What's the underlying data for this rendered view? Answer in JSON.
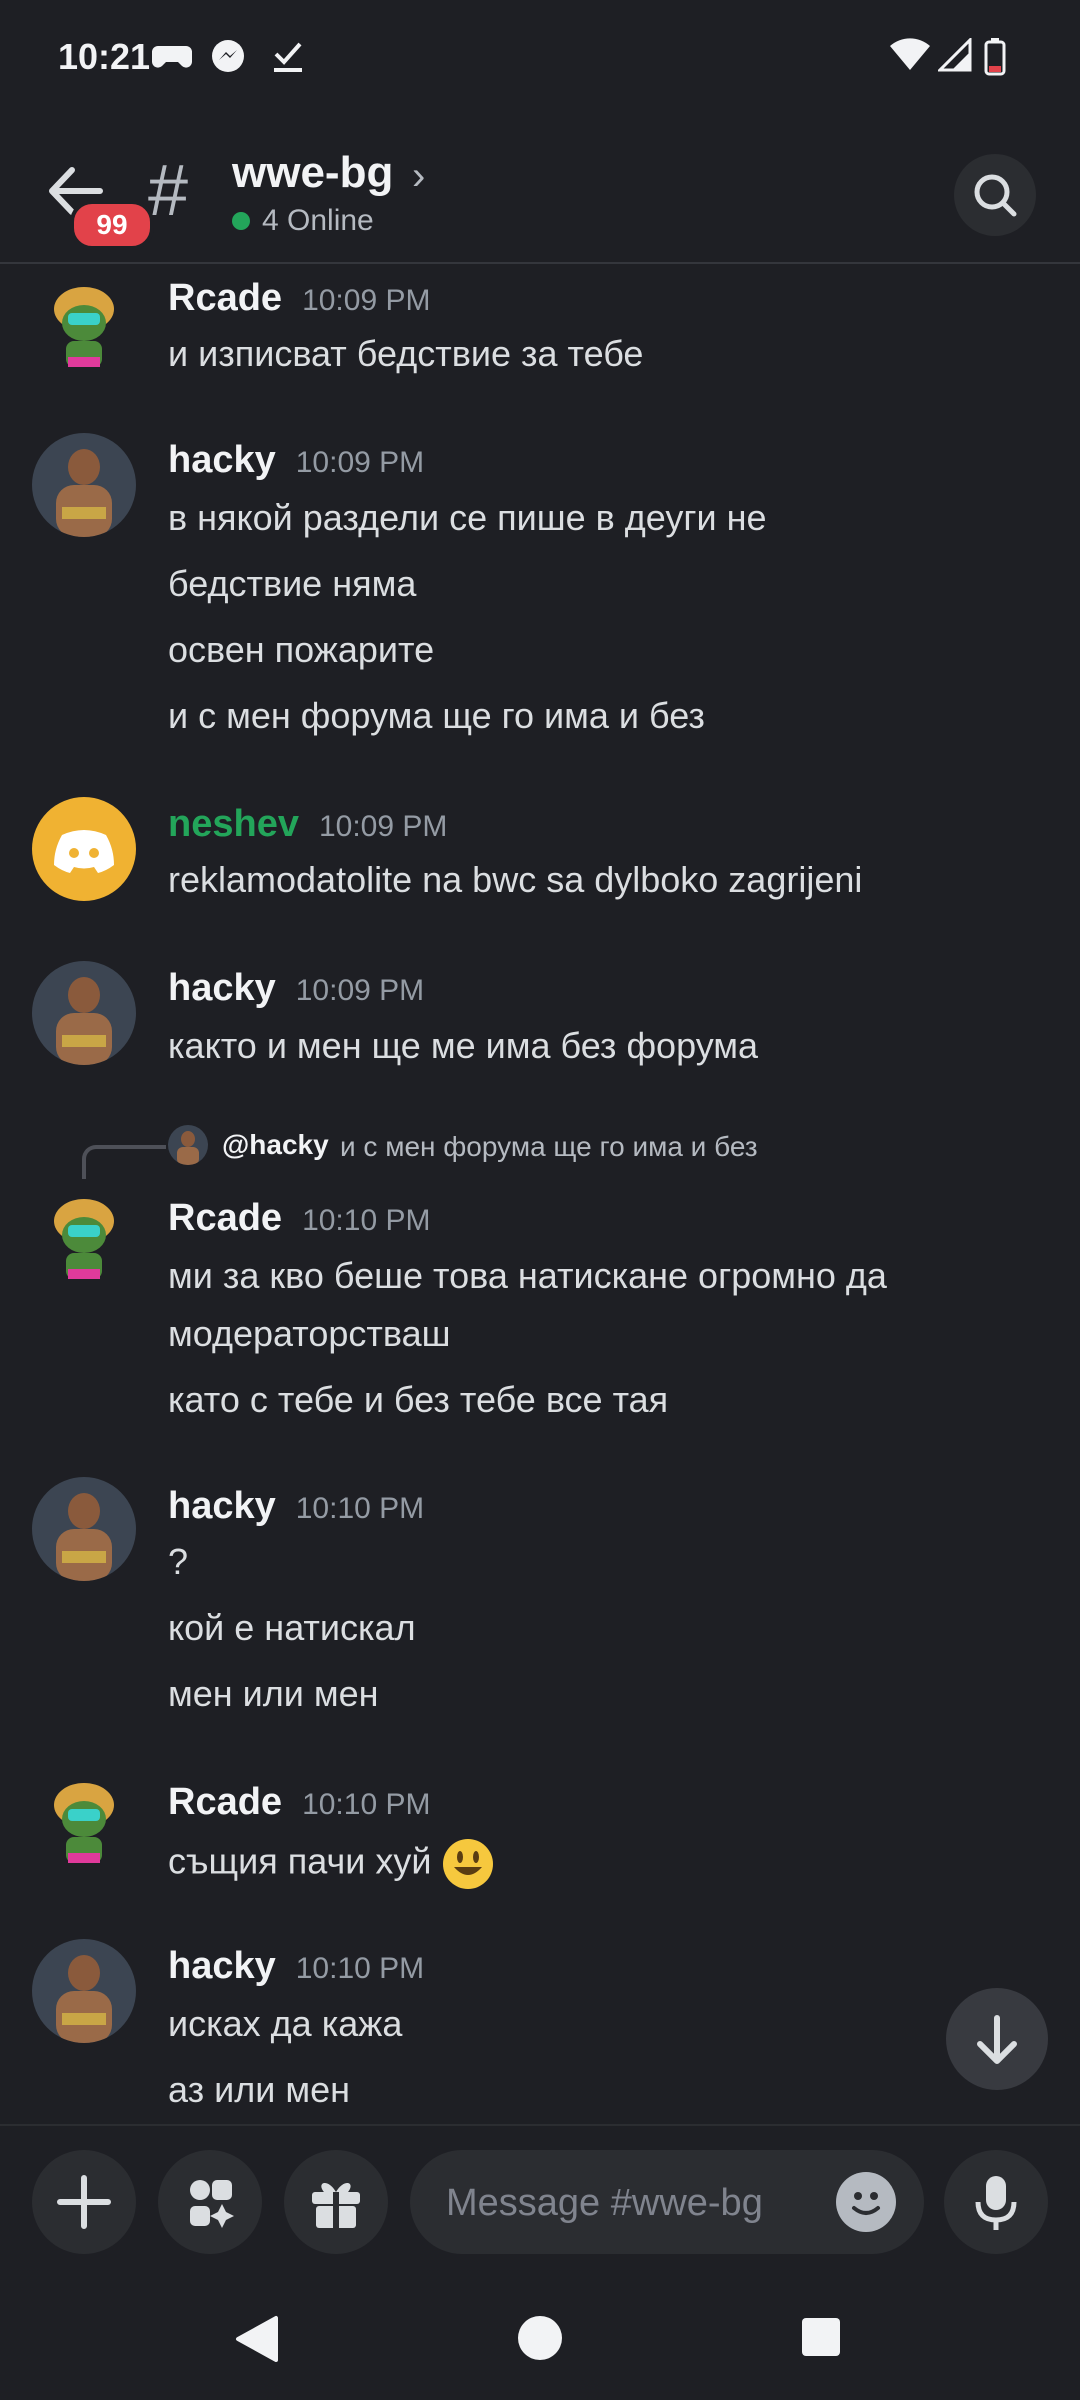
{
  "status_bar": {
    "time": "10:21"
  },
  "header": {
    "unread_badge": "99",
    "hash": "#",
    "channel_name": "wwe-bg",
    "online_text": "4 Online"
  },
  "messages": [
    {
      "author": "Rcade",
      "time": "10:09 PM",
      "lines": [
        "и изписват бедствие за тебе"
      ]
    },
    {
      "author": "hacky",
      "time": "10:09 PM",
      "lines": [
        "в някой раздели се пише в деуги не",
        "бедствие няма",
        "освен пожарите",
        "и с мен форума ще го има и без"
      ]
    },
    {
      "author": "neshev",
      "time": "10:09 PM",
      "lines": [
        "reklamodatolite na bwc sa dylboko zagrijeni"
      ]
    },
    {
      "author": "hacky",
      "time": "10:09 PM",
      "lines": [
        "както и мен ще ме има без форума"
      ]
    },
    {
      "reply": {
        "author": "@hacky",
        "text": "и с мен форума ще го има и без"
      },
      "author": "Rcade",
      "time": "10:10 PM",
      "lines": [
        "ми за кво беше това натискане огромно да",
        "модераторстваш",
        "като с тебе и без тебе все тая"
      ]
    },
    {
      "author": "hacky",
      "time": "10:10 PM",
      "lines": [
        "?",
        "кой е натискал",
        "мен или мен"
      ]
    },
    {
      "author": "Rcade",
      "time": "10:10 PM",
      "lines": [
        "същия пачи хуй"
      ]
    },
    {
      "author": "hacky",
      "time": "10:10 PM",
      "lines": [
        "исках да кажа",
        "аз или мен"
      ]
    }
  ],
  "composer": {
    "placeholder": "Message #wwe-bg"
  },
  "colors": {
    "background": "#1e1f24",
    "online": "#23a55a",
    "badge": "#e2424a",
    "discord_orange": "#f0b232"
  },
  "icons": [
    "back-arrow-icon",
    "hash-icon",
    "chevron-right-icon",
    "search-icon",
    "plus-icon",
    "apps-icon",
    "gift-icon",
    "emoji-icon",
    "mic-icon",
    "arrow-down-icon",
    "nav-back-icon",
    "nav-home-icon",
    "nav-recents-icon"
  ]
}
